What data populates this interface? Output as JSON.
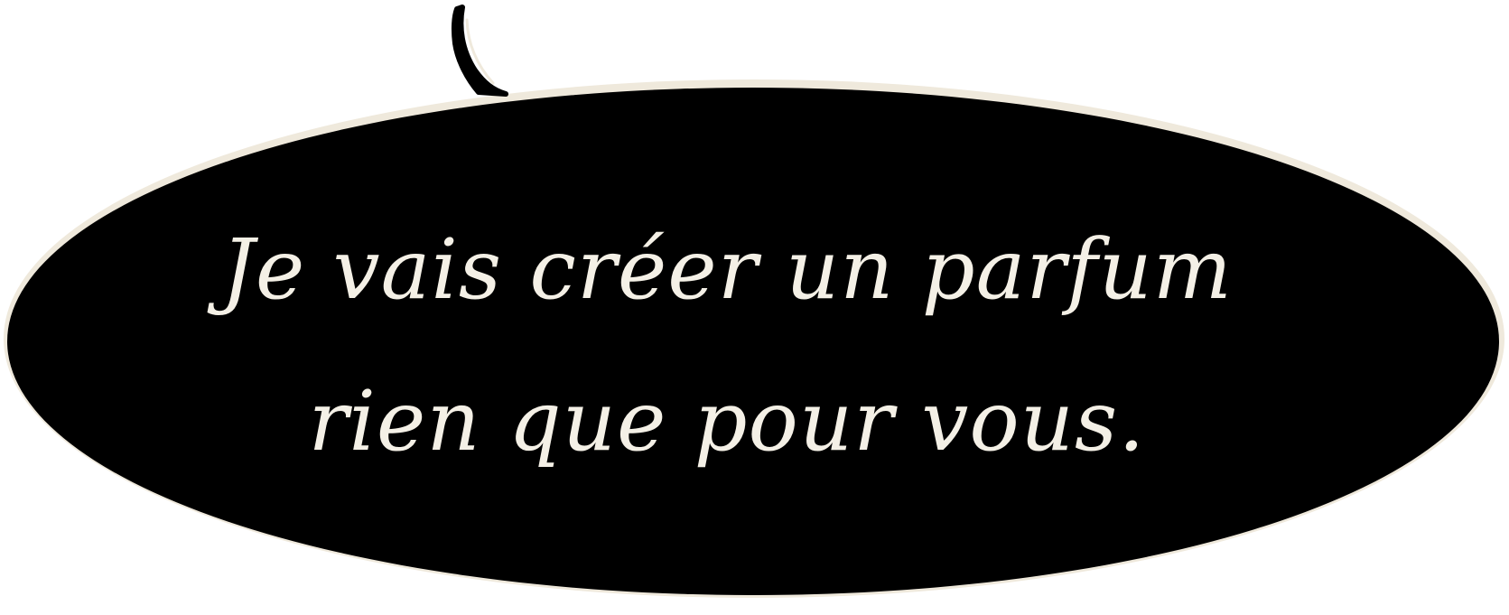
{
  "speech_bubble": {
    "lines": [
      "Je vais créer un parfum",
      "rien que pour vous."
    ],
    "fill_color": "#000000",
    "outline_color": "#efe9dc",
    "text_color": "#f4f0e6",
    "tail_direction": "up"
  }
}
